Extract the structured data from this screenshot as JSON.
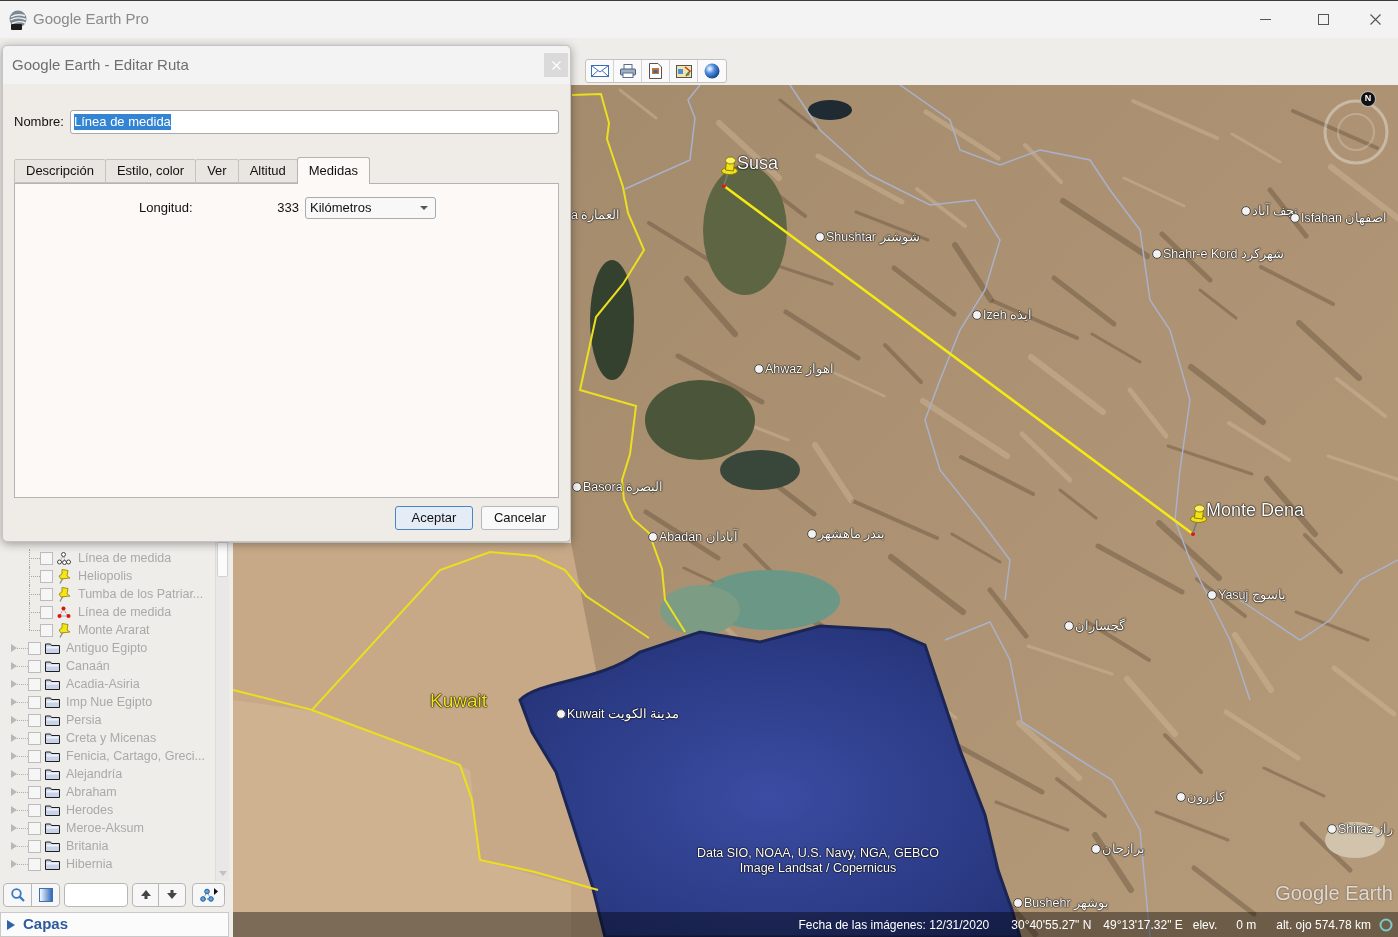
{
  "window": {
    "title": "Google Earth Pro"
  },
  "dialog": {
    "title": "Google Earth - Editar Ruta",
    "name_field": {
      "label": "Nombre:",
      "value": "Línea de medida",
      "text_highlighted": true
    },
    "tabs": [
      {
        "label": "Descripción",
        "selected": false
      },
      {
        "label": "Estilo, color",
        "selected": false
      },
      {
        "label": "Ver",
        "selected": false
      },
      {
        "label": "Altitud",
        "selected": false
      },
      {
        "label": "Medidas",
        "selected": true
      }
    ],
    "measurements": {
      "label": "Longitud:",
      "value": "333",
      "unit": "Kilómetros"
    },
    "buttons": [
      {
        "label": "Aceptar",
        "default": true
      },
      {
        "label": "Cancelar",
        "default": false
      }
    ]
  },
  "places_panel": {
    "disabled": true,
    "items": [
      {
        "children": [
          {
            "label": "Línea de medida",
            "kind": "path",
            "checked": false
          },
          {
            "label": "Heliopolis",
            "kind": "pin",
            "checked": false
          },
          {
            "label": "Tumba de los Patriar...",
            "kind": "pin",
            "checked": false
          },
          {
            "label": "Línea de medida",
            "kind": "editpath",
            "checked": false
          },
          {
            "label": "Monte Ararat",
            "kind": "pin",
            "checked": false
          }
        ]
      },
      {
        "label": "Antiguo Egipto",
        "kind": "folder",
        "checked": false,
        "expanded": false
      },
      {
        "label": "Canaán",
        "kind": "folder",
        "checked": false,
        "expanded": false
      },
      {
        "label": "Acadia-Asiria",
        "kind": "folder",
        "checked": false,
        "expanded": false
      },
      {
        "label": "Imp Nue Egipto",
        "kind": "folder",
        "checked": false,
        "expanded": false
      },
      {
        "label": "Persia",
        "kind": "folder",
        "checked": false,
        "expanded": false
      },
      {
        "label": "Creta y Micenas",
        "kind": "folder",
        "checked": false,
        "expanded": false
      },
      {
        "label": "Fenicia, Cartago, Greci...",
        "kind": "folder",
        "checked": false,
        "expanded": false
      },
      {
        "label": "Alejandría",
        "kind": "folder",
        "checked": false,
        "expanded": false
      },
      {
        "label": "Abraham",
        "kind": "folder",
        "checked": false,
        "expanded": false
      },
      {
        "label": "Herodes",
        "kind": "folder",
        "checked": false,
        "expanded": false
      },
      {
        "label": "Meroe-Aksum",
        "kind": "folder",
        "checked": false,
        "expanded": false
      },
      {
        "label": "Britania",
        "kind": "folder",
        "checked": false,
        "expanded": false
      },
      {
        "label": "Hibernia",
        "kind": "folder",
        "checked": false,
        "expanded": false
      }
    ]
  },
  "layers_panel": {
    "title": "Capas",
    "expanded": false
  },
  "map": {
    "places": [
      {
        "label": "Susa",
        "kind": "pin"
      },
      {
        "label": "a العمارة",
        "kind": "label"
      },
      {
        "label": "Shushtar شوشتر",
        "kind": "city"
      },
      {
        "label": "نجف آباد",
        "kind": "city"
      },
      {
        "label": "Isfahan اصفهان",
        "kind": "city"
      },
      {
        "label": "Shahr-e Kord شهرکرد",
        "kind": "city"
      },
      {
        "label": "Izeh ایذه",
        "kind": "city"
      },
      {
        "label": "Ahwaz اهواز",
        "kind": "city"
      },
      {
        "label": "Basora البصرة",
        "kind": "city"
      },
      {
        "label": "Monte Dena",
        "kind": "pin"
      },
      {
        "label": "Abadán آبادان",
        "kind": "city"
      },
      {
        "label": "بندر ماهشهر",
        "kind": "city"
      },
      {
        "label": "Yasuj یاسوج",
        "kind": "city"
      },
      {
        "label": "گچساران",
        "kind": "city"
      },
      {
        "label": "Kuwait",
        "kind": "country"
      },
      {
        "label": "Kuwait مدينة الكويت",
        "kind": "city"
      },
      {
        "label": "کازرون",
        "kind": "city"
      },
      {
        "label": "Shiraz راز",
        "kind": "city"
      },
      {
        "label": "برازجان",
        "kind": "city"
      },
      {
        "label": "Bushehr بوشهر",
        "kind": "city"
      }
    ],
    "attribution": [
      "Data SIO, NOAA, U.S. Navy, NGA, GEBCO",
      "Image Landsat / Copernicus"
    ],
    "logo": "Google Earth",
    "compass": {
      "north": "N"
    }
  },
  "status_bar": {
    "imagery_date": "Fecha de las imágenes: 12/31/2020",
    "latitude": "30°40'55.27\" N",
    "longitude": "49°13'17.32\" E",
    "elevation_label": "elev.",
    "elevation": "0 m",
    "eye_altitude": "alt. ojo 574.78 km"
  }
}
